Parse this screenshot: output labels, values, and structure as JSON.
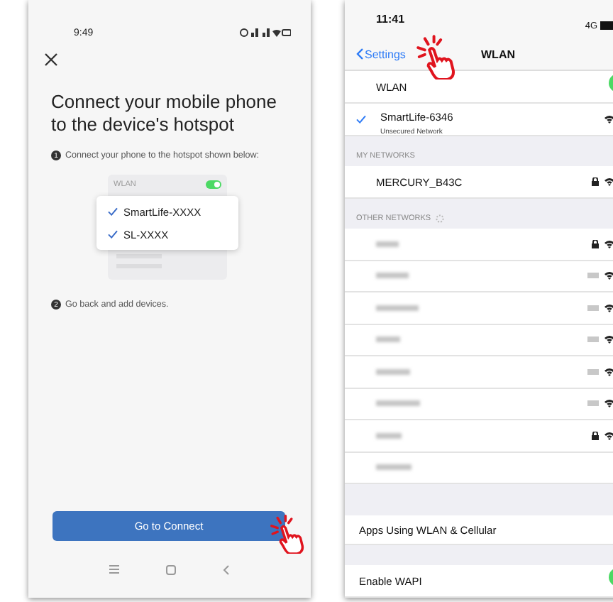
{
  "left_screen": {
    "status_bar": {
      "time": "9:49"
    },
    "title": "Connect your mobile phone to the device's hotspot",
    "steps": [
      {
        "number": "1",
        "text": "Connect your phone to the hotspot shown below:"
      },
      {
        "number": "2",
        "text": "Go back and add devices."
      }
    ],
    "illustration": {
      "header": "WLAN",
      "switch_on": true,
      "networks": [
        {
          "name": "SmartLife-XXXX",
          "checked": true
        },
        {
          "name": "SL-XXXX",
          "checked": true
        }
      ]
    },
    "connect_button": "Go to Connect"
  },
  "right_screen": {
    "status_bar": {
      "time": "11:41",
      "network": "4G"
    },
    "nav": {
      "back": "Settings",
      "title": "WLAN"
    },
    "wlan_row": {
      "label": "WLAN",
      "on": true
    },
    "current_network": {
      "name": "SmartLife-6346",
      "subtitle": "Unsecured Network",
      "connected": true
    },
    "my_networks": {
      "header": "MY NETWORKS",
      "networks": [
        {
          "name": "MERCURY_B43C",
          "locked": true
        }
      ]
    },
    "other_networks": {
      "header": "OTHER NETWORKS",
      "rows": [
        {
          "locked": true
        },
        {
          "locked": false
        },
        {
          "locked": false
        },
        {
          "locked": false
        },
        {
          "locked": false
        },
        {
          "locked": false
        },
        {
          "locked": true
        },
        {}
      ]
    },
    "apps_row": "Apps Using WLAN & Cellular",
    "wapi": {
      "label": "Enable WAPI",
      "on": true
    }
  }
}
